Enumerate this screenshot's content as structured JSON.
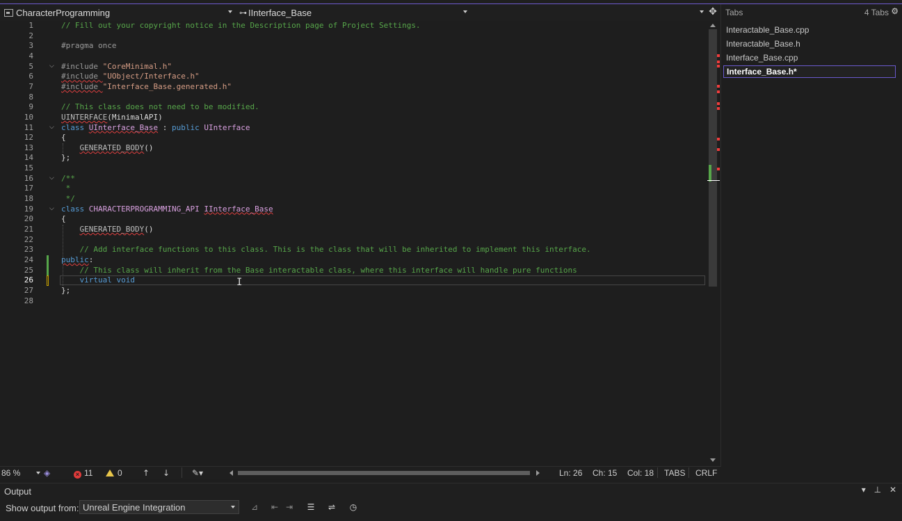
{
  "nav": {
    "project": "CharacterProgramming",
    "symbol": "IInterface_Base",
    "member": ""
  },
  "tabs_panel": {
    "title": "Tabs",
    "count": "4 Tabs",
    "items": [
      {
        "label": "Interactable_Base.cpp",
        "active": false
      },
      {
        "label": "Interactable_Base.h",
        "active": false
      },
      {
        "label": "Interface_Base.cpp",
        "active": false
      },
      {
        "label": "Interface_Base.h*",
        "active": true
      }
    ]
  },
  "editor": {
    "current_line": 26,
    "lines": [
      {
        "n": "1",
        "parts": [
          [
            "c-cmt",
            "// Fill out your copyright notice in the Description page of Project Settings."
          ]
        ]
      },
      {
        "n": "2",
        "parts": []
      },
      {
        "n": "3",
        "parts": [
          [
            "c-pp",
            "#pragma once"
          ]
        ]
      },
      {
        "n": "4",
        "parts": []
      },
      {
        "n": "5",
        "fold": true,
        "parts": [
          [
            "c-pp",
            "#include "
          ],
          [
            "c-str",
            "\"CoreMinimal.h\""
          ]
        ]
      },
      {
        "n": "6",
        "parts": [
          [
            "c-pp sq",
            "#include "
          ],
          [
            "c-str",
            "\"UObject/Interface.h\""
          ]
        ]
      },
      {
        "n": "7",
        "parts": [
          [
            "c-pp sq",
            "#include "
          ],
          [
            "c-str",
            "\"Interface_Base.generated.h\""
          ]
        ]
      },
      {
        "n": "8",
        "parts": []
      },
      {
        "n": "9",
        "parts": [
          [
            "c-cmt",
            "// This class does not need to be modified."
          ]
        ]
      },
      {
        "n": "10",
        "parts": [
          [
            "c-macro sq",
            "UINTERFACE"
          ],
          [
            "",
            "(MinimalAPI)"
          ]
        ]
      },
      {
        "n": "11",
        "fold": true,
        "parts": [
          [
            "c-kw",
            "class "
          ],
          [
            "c-type sq",
            "UInterface_Base"
          ],
          [
            "",
            " : "
          ],
          [
            "c-kw",
            "public "
          ],
          [
            "c-type",
            "UInterface"
          ]
        ]
      },
      {
        "n": "12",
        "parts": [
          [
            "",
            "{"
          ]
        ]
      },
      {
        "n": "13",
        "parts": [
          [
            "",
            "    "
          ],
          [
            "c-macro sq",
            "GENERATED_BODY"
          ],
          [
            "",
            "()"
          ]
        ]
      },
      {
        "n": "14",
        "parts": [
          [
            "",
            "};"
          ]
        ]
      },
      {
        "n": "15",
        "parts": []
      },
      {
        "n": "16",
        "fold": true,
        "parts": [
          [
            "c-cmt",
            "/**"
          ]
        ]
      },
      {
        "n": "17",
        "parts": [
          [
            "c-cmt",
            " *"
          ]
        ]
      },
      {
        "n": "18",
        "parts": [
          [
            "c-cmt",
            " */"
          ]
        ]
      },
      {
        "n": "19",
        "fold": true,
        "parts": [
          [
            "c-kw",
            "class "
          ],
          [
            "c-type",
            "CHARACTERPROGRAMMING_API "
          ],
          [
            "c-type sq",
            "IInterface_Base"
          ]
        ]
      },
      {
        "n": "20",
        "parts": [
          [
            "",
            "{"
          ]
        ]
      },
      {
        "n": "21",
        "parts": [
          [
            "",
            "    "
          ],
          [
            "c-macro sq",
            "GENERATED_BODY"
          ],
          [
            "",
            "()"
          ]
        ]
      },
      {
        "n": "22",
        "parts": []
      },
      {
        "n": "23",
        "parts": [
          [
            "",
            "    "
          ],
          [
            "c-cmt",
            "// Add interface functions to this class. This is the class that will be inherited to implement this interface."
          ]
        ]
      },
      {
        "n": "24",
        "parts": [
          [
            "c-kw sq",
            "public"
          ],
          [
            "",
            ":"
          ]
        ]
      },
      {
        "n": "25",
        "parts": [
          [
            "",
            "    "
          ],
          [
            "c-cmt",
            "// This class will inherit from the Base interactable class, where this interface will handle pure functions"
          ]
        ]
      },
      {
        "n": "26",
        "parts": [
          [
            "",
            "    "
          ],
          [
            "c-kw",
            "virtual void"
          ]
        ]
      },
      {
        "n": "27",
        "parts": [
          [
            "",
            "};"
          ]
        ]
      },
      {
        "n": "28",
        "parts": []
      }
    ]
  },
  "status": {
    "zoom": "86 %",
    "errors": "11",
    "warnings": "0",
    "ln": "Ln: 26",
    "ch": "Ch: 15",
    "col": "Col: 18",
    "indent": "TABS",
    "eol": "CRLF"
  },
  "output": {
    "title": "Output",
    "show_label": "Show output from:",
    "source": "Unreal Engine Integration"
  },
  "colors": {
    "accent": "#6f5bd0",
    "error": "#f03c3c",
    "comment": "#57a64a",
    "keyword": "#569cd6",
    "type": "#d8a0df",
    "string": "#d69d85"
  }
}
